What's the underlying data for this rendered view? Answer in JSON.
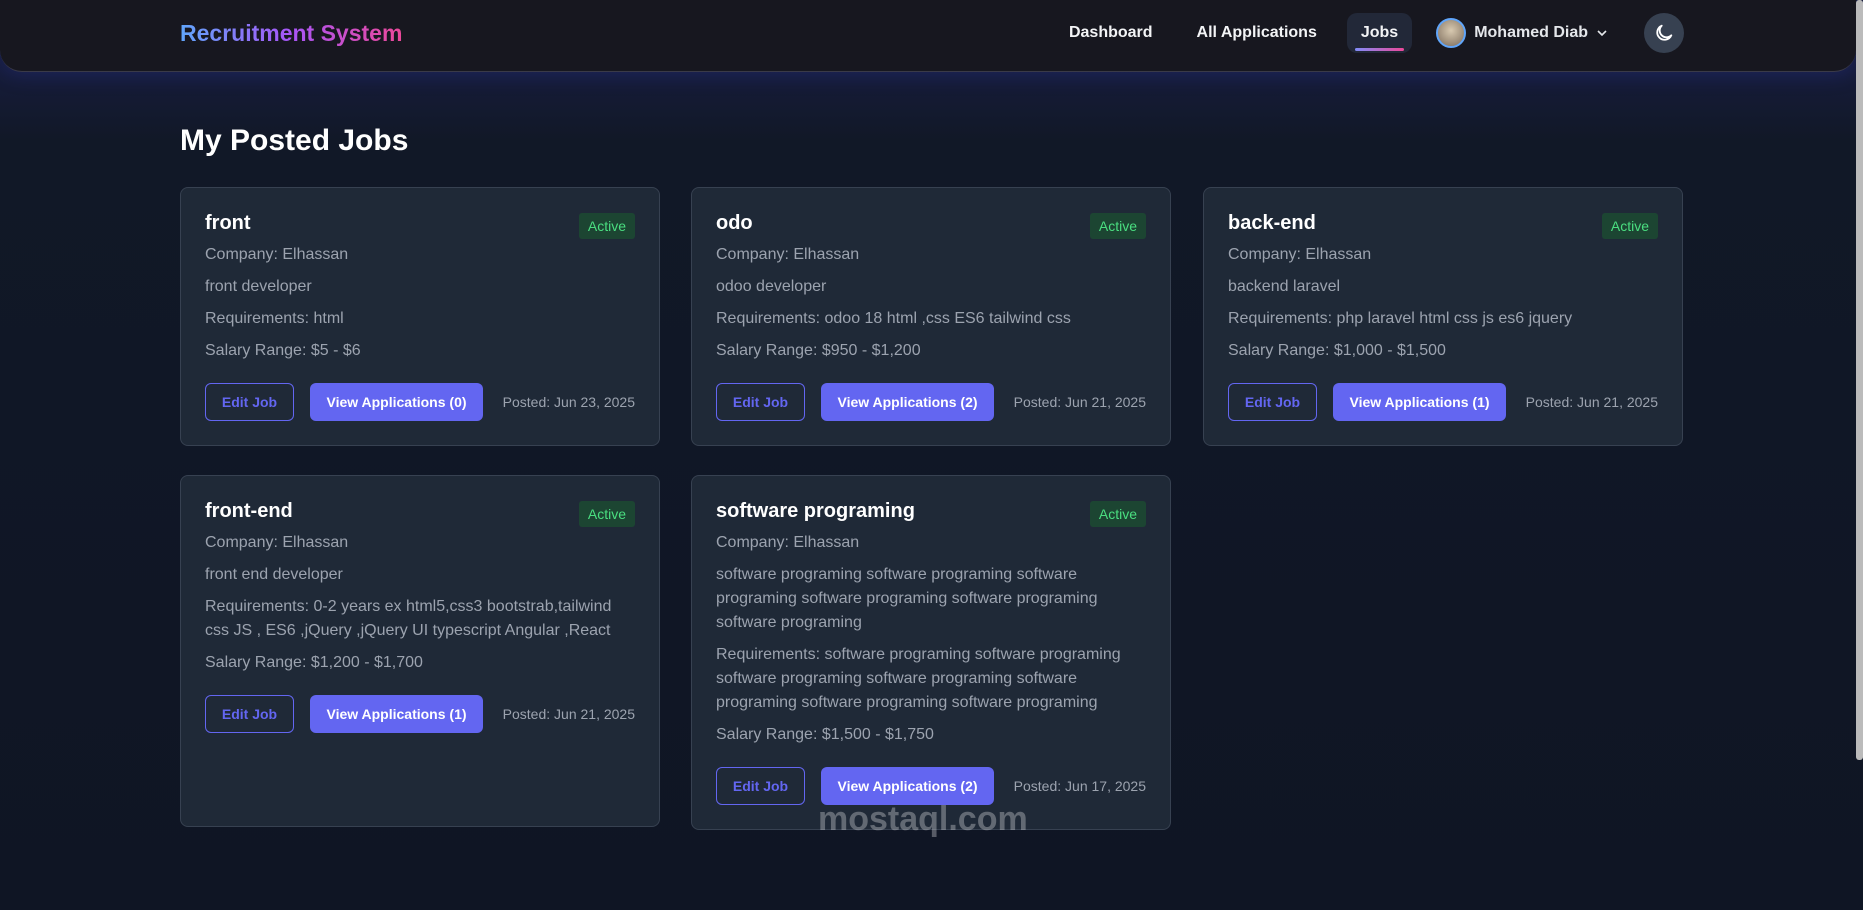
{
  "nav": {
    "logo": "Recruitment System",
    "links": [
      "Dashboard",
      "All Applications",
      "Jobs"
    ],
    "user": "Mohamed Diab"
  },
  "page_title": "My Posted Jobs",
  "jobs": [
    {
      "title": "front",
      "status": "Active",
      "company": "Company: Elhassan",
      "description": "front developer",
      "requirements": "Requirements: html",
      "salary": "Salary Range: $5 - $6",
      "edit": "Edit Job",
      "view": "View Applications (0)",
      "posted": "Posted: Jun 23, 2025"
    },
    {
      "title": "odo",
      "status": "Active",
      "company": "Company: Elhassan",
      "description": "odoo developer",
      "requirements": "Requirements: odoo 18 html ,css ES6 tailwind css",
      "salary": "Salary Range: $950 - $1,200",
      "edit": "Edit Job",
      "view": "View Applications (2)",
      "posted": "Posted: Jun 21, 2025"
    },
    {
      "title": "back-end",
      "status": "Active",
      "company": "Company: Elhassan",
      "description": "backend laravel",
      "requirements": "Requirements: php laravel html css js es6 jquery",
      "salary": "Salary Range: $1,000 - $1,500",
      "edit": "Edit Job",
      "view": "View Applications (1)",
      "posted": "Posted: Jun 21, 2025"
    },
    {
      "title": "front-end",
      "status": "Active",
      "company": "Company: Elhassan",
      "description": "front end developer",
      "requirements": "Requirements: 0-2 years ex html5,css3 bootstrab,tailwind css JS , ES6 ,jQuery ,jQuery UI typescript Angular ,React",
      "salary": "Salary Range: $1,200 - $1,700",
      "edit": "Edit Job",
      "view": "View Applications (1)",
      "posted": "Posted: Jun 21, 2025"
    },
    {
      "title": "software programing",
      "status": "Active",
      "company": "Company: Elhassan",
      "description": "software programing software programing software programing software programing software programing software programing",
      "requirements": "Requirements: software programing software programing software programing software programing software programing software programing software programing",
      "salary": "Salary Range: $1,500 - $1,750",
      "edit": "Edit Job",
      "view": "View Applications (2)",
      "posted": "Posted: Jun 17, 2025"
    }
  ],
  "watermark": "mostaql.com"
}
